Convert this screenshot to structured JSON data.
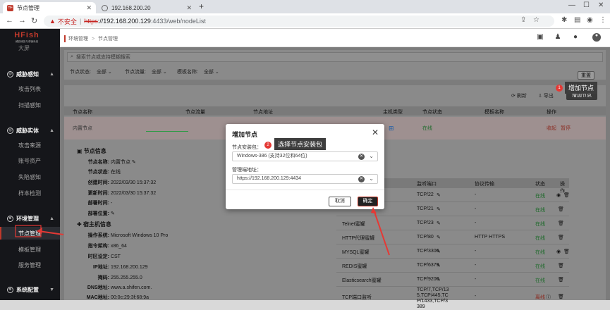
{
  "browser": {
    "tabs": [
      {
        "title": "节点管理",
        "favicon": "hfish-favicon"
      },
      {
        "title": "192.168.200.20",
        "favicon": "globe-icon"
      }
    ],
    "url": {
      "warning": "不安全",
      "protocol": "https",
      "host": "://192.168.200.129",
      "path": ":4433/web/nodeList"
    }
  },
  "sidebar": {
    "logo_title": "HFish",
    "logo_subtitle": "威胁捕捉与诱骗系统",
    "cut_item": "大屏",
    "sections": [
      {
        "label": "威胁感知",
        "items": [
          "攻击列表",
          "扫描感知"
        ]
      },
      {
        "label": "威胁实体",
        "items": [
          "攻击来源",
          "账号资产",
          "失陷感知",
          "样本检测"
        ]
      },
      {
        "label": "环境管理",
        "items": [
          "节点管理",
          "模板管理",
          "服务管理"
        ]
      },
      {
        "label": "系统配置",
        "items": []
      }
    ],
    "active_item": "节点管理"
  },
  "header": {
    "breadcrumb_root": "环境管理",
    "breadcrumb_sep": ">",
    "breadcrumb_current": "节点管理"
  },
  "filters": {
    "search_placeholder": "搜索节点或支持模糊搜索",
    "node_status_label": "节点状态:",
    "node_status_value": "全部",
    "node_traffic_label": "节点流量:",
    "node_traffic_value": "全部",
    "template_label": "模板名称:",
    "template_value": "全部",
    "reset": "重置"
  },
  "toolbar": {
    "refresh": "刷新",
    "export": "导出",
    "add_node": "增加节点"
  },
  "table": {
    "headers": [
      "节点名称",
      "节点流量",
      "节点地址",
      "主机类型",
      "节点状态",
      "模板名称",
      "操作"
    ],
    "row": {
      "name": "内置节点",
      "status": "在线",
      "op1": "收起",
      "op2": "暂停"
    }
  },
  "node_info": {
    "title": "节点信息",
    "fields": [
      {
        "k": "节点名称:",
        "v": "内置节点"
      },
      {
        "k": "节点状态:",
        "v": "在线"
      },
      {
        "k": "创建时间:",
        "v": "2022/03/30 15:37:32"
      },
      {
        "k": "更新时间:",
        "v": "2022/03/30 15:37:32"
      },
      {
        "k": "部署时间:",
        "v": "-"
      },
      {
        "k": "部署位置:",
        "v": ""
      }
    ]
  },
  "host_info": {
    "title": "宿主机信息",
    "fields": [
      {
        "k": "操作系统:",
        "v": "Microsoft Windows 10 Pro"
      },
      {
        "k": "指令架构:",
        "v": "x86_64"
      },
      {
        "k": "时区设定:",
        "v": "CST"
      },
      {
        "k": "IP地址:",
        "v": "192.168.200.129"
      },
      {
        "k": "掩码:",
        "v": "255.255.255.0"
      },
      {
        "k": "DNS地址:",
        "v": "www.a.shifen.com."
      },
      {
        "k": "MAC地址:",
        "v": "00:0c:29:3f:68:9a"
      }
    ]
  },
  "services": {
    "headers": [
      "",
      "监听端口",
      "协议传输",
      "状态",
      "操作"
    ],
    "rows": [
      {
        "name": "",
        "port": "TCP/22",
        "proto": "-",
        "status": "在线"
      },
      {
        "name": "",
        "port": "TCP/21",
        "proto": "-",
        "status": "在线"
      },
      {
        "name": "Telnet蜜罐",
        "port": "TCP/23",
        "proto": "-",
        "status": "在线"
      },
      {
        "name": "HTTP代理蜜罐",
        "port": "TCP/80",
        "proto": "HTTP  HTTPS",
        "status": "在线"
      },
      {
        "name": "MYSQL蜜罐",
        "port": "TCP/3306",
        "proto": "-",
        "status": "在线"
      },
      {
        "name": "REDIS蜜罐",
        "port": "TCP/6379",
        "proto": "-",
        "status": "在线"
      },
      {
        "name": "Elasticsearch蜜罐",
        "port": "TCP/9200",
        "proto": "-",
        "status": "在线"
      },
      {
        "name": "TCP端口监听",
        "port": "TCP/7,TCP/13 5,TCP/445,TC P/1433,TCP/3 389",
        "proto": "-",
        "status": "离线"
      }
    ]
  },
  "modal": {
    "title": "增加节点",
    "package_label": "节点安装包：",
    "package_value": "Windows-386 (支持32位和64位)",
    "mgmt_label": "管理端地址：",
    "mgmt_value": "https://192.168.200.129:4434",
    "cancel": "取消",
    "ok": "确定"
  },
  "annotations": {
    "step1_num": "1",
    "step1_text": "增加节点",
    "step2_num": "2",
    "step2_text": "选择节点安装包",
    "arrow_color": "#e53935"
  }
}
